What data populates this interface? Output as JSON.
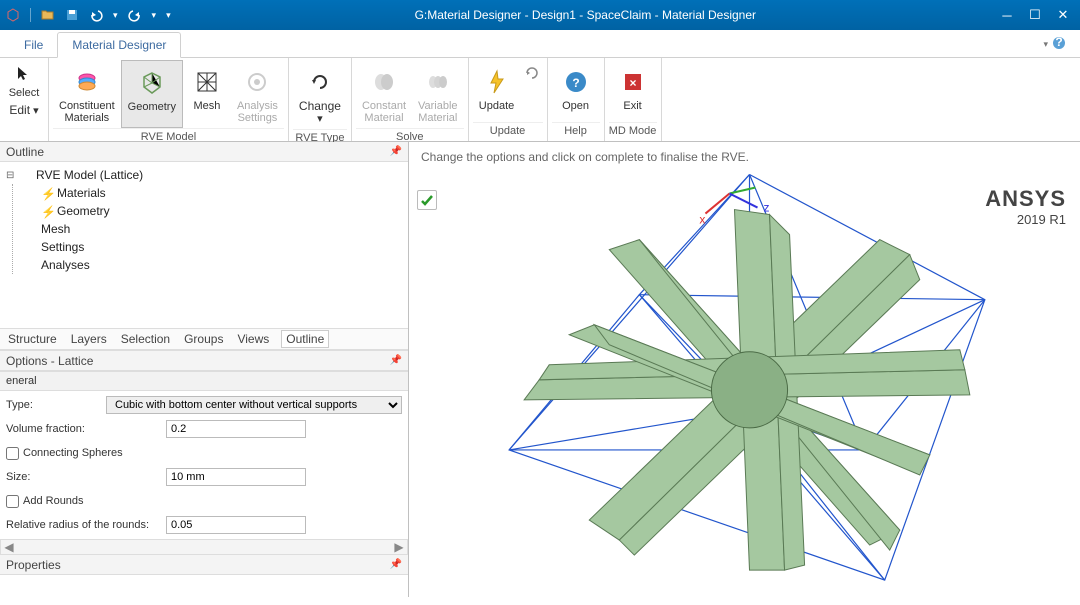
{
  "window": {
    "title": "G:Material Designer - Design1 - SpaceClaim - Material Designer"
  },
  "menubar": {
    "file": "File",
    "material_designer": "Material Designer"
  },
  "ribbon": {
    "select": {
      "label": "Select"
    },
    "edit": {
      "label": "Edit"
    },
    "constituent": {
      "label": "Constituent\nMaterials"
    },
    "geometry": {
      "label": "Geometry"
    },
    "mesh": {
      "label": "Mesh"
    },
    "analysis": {
      "label": "Analysis\nSettings"
    },
    "change": {
      "label": "Change"
    },
    "constant": {
      "label": "Constant\nMaterial"
    },
    "variable": {
      "label": "Variable\nMaterial"
    },
    "update": {
      "label": "Update"
    },
    "open": {
      "label": "Open"
    },
    "exit": {
      "label": "Exit"
    },
    "groups": {
      "rve_model": "RVE Model",
      "rve_type": "RVE Type",
      "solve": "Solve",
      "update": "Update",
      "help": "Help",
      "md_mode": "MD Mode"
    }
  },
  "outline_panel": {
    "title": "Outline",
    "root": "RVE Model (Lattice)",
    "items": [
      "Materials",
      "Geometry",
      "Mesh",
      "Settings",
      "Analyses"
    ]
  },
  "tabs": [
    "Structure",
    "Layers",
    "Selection",
    "Groups",
    "Views",
    "Outline"
  ],
  "options_panel": {
    "title": "Options - Lattice",
    "section": "eneral",
    "type": {
      "label": "Type:",
      "value": "Cubic with bottom center without vertical supports"
    },
    "volume_fraction": {
      "label": "Volume fraction:",
      "value": "0.2"
    },
    "connecting_spheres": {
      "label": "Connecting Spheres"
    },
    "size": {
      "label": "Size:",
      "value": "10 mm"
    },
    "add_rounds": {
      "label": "Add Rounds"
    },
    "radius": {
      "label": "Relative radius of the rounds:",
      "value": "0.05"
    }
  },
  "properties": {
    "title": "Properties"
  },
  "viewport": {
    "hint": "Change the options and click on complete to finalise the RVE.",
    "brand_name": "ANSYS",
    "brand_version": "2019 R1",
    "axes": {
      "x": "x",
      "z": "z"
    }
  }
}
